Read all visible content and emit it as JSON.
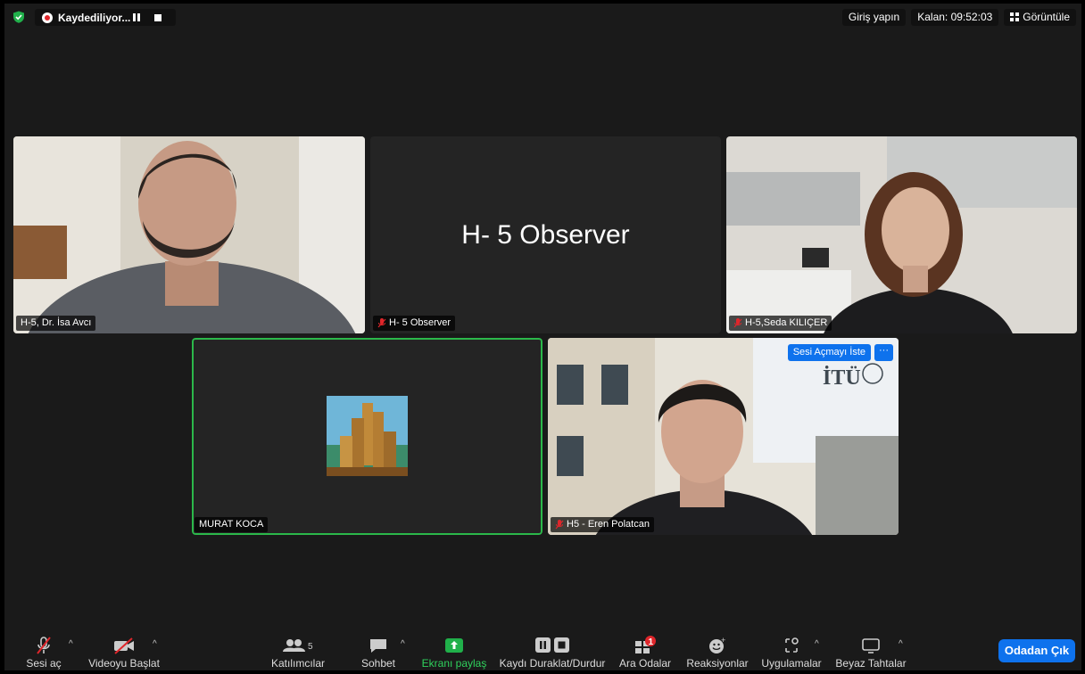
{
  "topbar": {
    "recording_label": "Kaydediliyor...",
    "sign_in": "Giriş yapın",
    "remaining": "Kalan: 09:52:03",
    "view": "Görüntüle"
  },
  "tiles": [
    {
      "name": "H-5, Dr. İsa Avcı",
      "muted": false
    },
    {
      "name": "H- 5 Observer",
      "center_text": "H- 5 Observer",
      "muted": true
    },
    {
      "name": "H-5,Seda KILIÇER",
      "muted": true
    },
    {
      "name": "MURAT KOCA",
      "muted": false,
      "active_speaker": true
    },
    {
      "name": "H5 - Eren Polatcan",
      "muted": true,
      "ask_unmute": "Sesi Açmayı İste",
      "more": "···",
      "watermark": "İTÜ"
    }
  ],
  "toolbar": {
    "unmute": "Sesi aç",
    "start_video": "Videoyu Başlat",
    "participants": "Katılımcılar",
    "participants_count": "5",
    "chat": "Sohbet",
    "share_screen": "Ekranı paylaş",
    "record": "Kaydı Duraklat/Durdur",
    "breakout": "Ara Odalar",
    "breakout_badge": "1",
    "reactions": "Reaksiyonlar",
    "apps": "Uygulamalar",
    "whiteboards": "Beyaz Tahtalar",
    "leave": "Odadan Çık"
  },
  "colors": {
    "accent_blue": "#0e72ed",
    "share_green": "#20b04a",
    "active_speaker_border": "#2bb84a",
    "mute_red": "#e0262b"
  }
}
